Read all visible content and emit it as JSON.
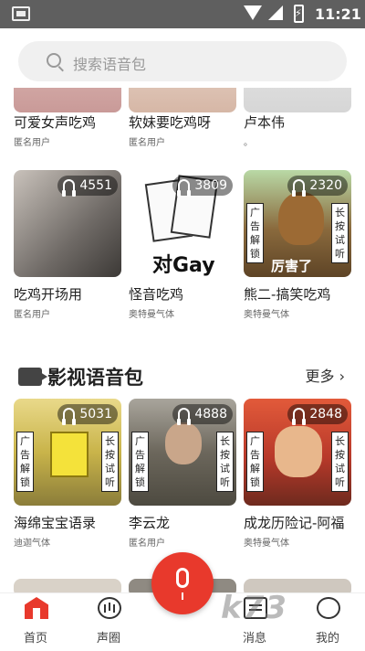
{
  "status": {
    "time": "11:21"
  },
  "search": {
    "placeholder": "搜索语音包"
  },
  "row0": [
    {
      "title": "可爱女声吃鸡",
      "author": "匿名用户"
    },
    {
      "title": "软妹要吃鸡呀",
      "author": "匿名用户"
    },
    {
      "title": "卢本伟",
      "author": "。"
    }
  ],
  "row1": [
    {
      "title": "吃鸡开场用",
      "author": "匿名用户",
      "plays": "4551"
    },
    {
      "title": "怪音吃鸡",
      "author": "奥特曼气体",
      "plays": "3809",
      "image_text": "对Gay"
    },
    {
      "title": "熊二-搞笑吃鸡",
      "author": "奥特曼气体",
      "plays": "2320",
      "tag_left": "广告解锁",
      "tag_right": "长按试听",
      "image_text": "厉害了"
    }
  ],
  "section": {
    "title": "影视语音包",
    "more": "更多"
  },
  "row2": [
    {
      "title": "海绵宝宝语录",
      "author": "迪迦气体",
      "plays": "5031",
      "tag_left": "广告解锁",
      "tag_right": "长按试听"
    },
    {
      "title": "李云龙",
      "author": "匿名用户",
      "plays": "4888",
      "tag_left": "广告解锁",
      "tag_right": "长按试听"
    },
    {
      "title": "成龙历险记-阿福",
      "author": "奥特曼气体",
      "plays": "2848",
      "tag_left": "广告解锁",
      "tag_right": "长按试听"
    }
  ],
  "nav": {
    "home": "首页",
    "circle": "声圈",
    "messages": "消息",
    "me": "我的"
  },
  "watermark": "k73"
}
